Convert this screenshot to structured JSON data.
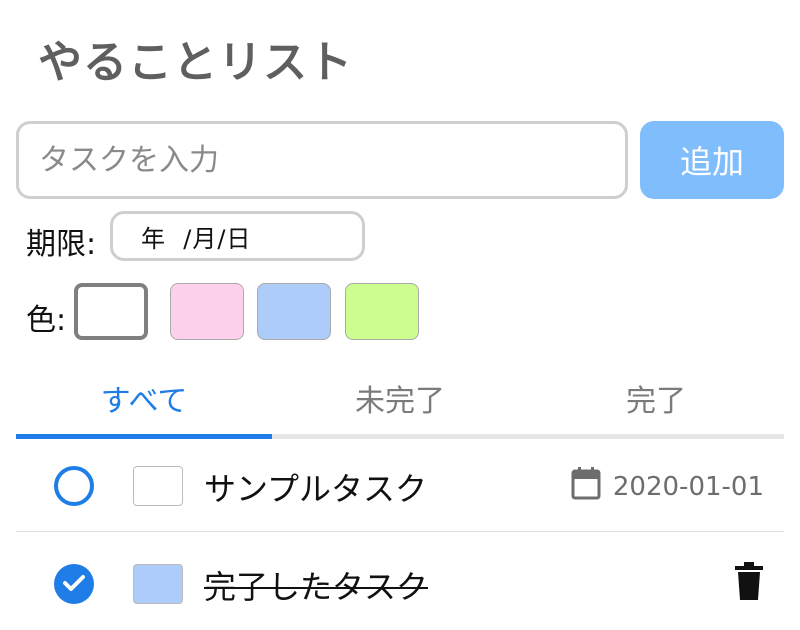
{
  "app": {
    "title": "やることリスト"
  },
  "new_task": {
    "placeholder": "タスクを入力",
    "add_label": "追加"
  },
  "due": {
    "label": "期限:",
    "date_placeholder": "年  /月/日"
  },
  "color": {
    "label": "色:",
    "swatches": [
      "#ffffff",
      "#fdd0ec",
      "#adccfa",
      "#cdfd8f"
    ],
    "selected_index": 0
  },
  "tabs": [
    {
      "label": "すべて",
      "active": true
    },
    {
      "label": "未完了",
      "active": false
    },
    {
      "label": "完了",
      "active": false
    }
  ],
  "tasks": [
    {
      "text": "サンプルタスク",
      "completed": false,
      "color": "#ffffff",
      "due": "2020-01-01",
      "icon": "calendar-icon"
    },
    {
      "text": "完了したタスク",
      "completed": true,
      "color": "#adccfa",
      "icon": "trash-icon"
    }
  ],
  "theme": {
    "accent": "#1e7de6",
    "button": "#80bdfd"
  }
}
